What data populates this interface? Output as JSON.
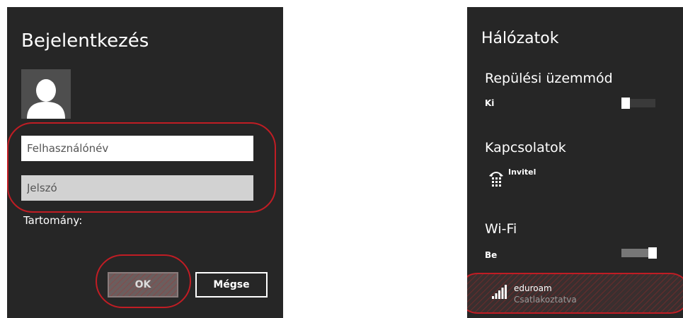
{
  "login": {
    "title": "Bejelentkezés",
    "username_placeholder": "Felhasználónév",
    "password_placeholder": "Jelszó",
    "domain_label": "Tartomány:",
    "ok_label": "OK",
    "cancel_label": "Mégse"
  },
  "networks": {
    "title": "Hálózatok",
    "airplane_mode": {
      "label": "Repülési üzemmód",
      "state": "Ki"
    },
    "connections": {
      "label": "Kapcsolatok",
      "items": [
        {
          "name": "Invitel",
          "icon": "phone-icon"
        }
      ]
    },
    "wifi": {
      "label": "Wi-Fi",
      "state": "Be",
      "networks": [
        {
          "name": "eduroam",
          "status": "Csatlakoztatva",
          "icon": "wifi-signal-icon"
        }
      ]
    }
  },
  "colors": {
    "panel_bg": "#262626",
    "highlight_red": "#c01d24"
  }
}
